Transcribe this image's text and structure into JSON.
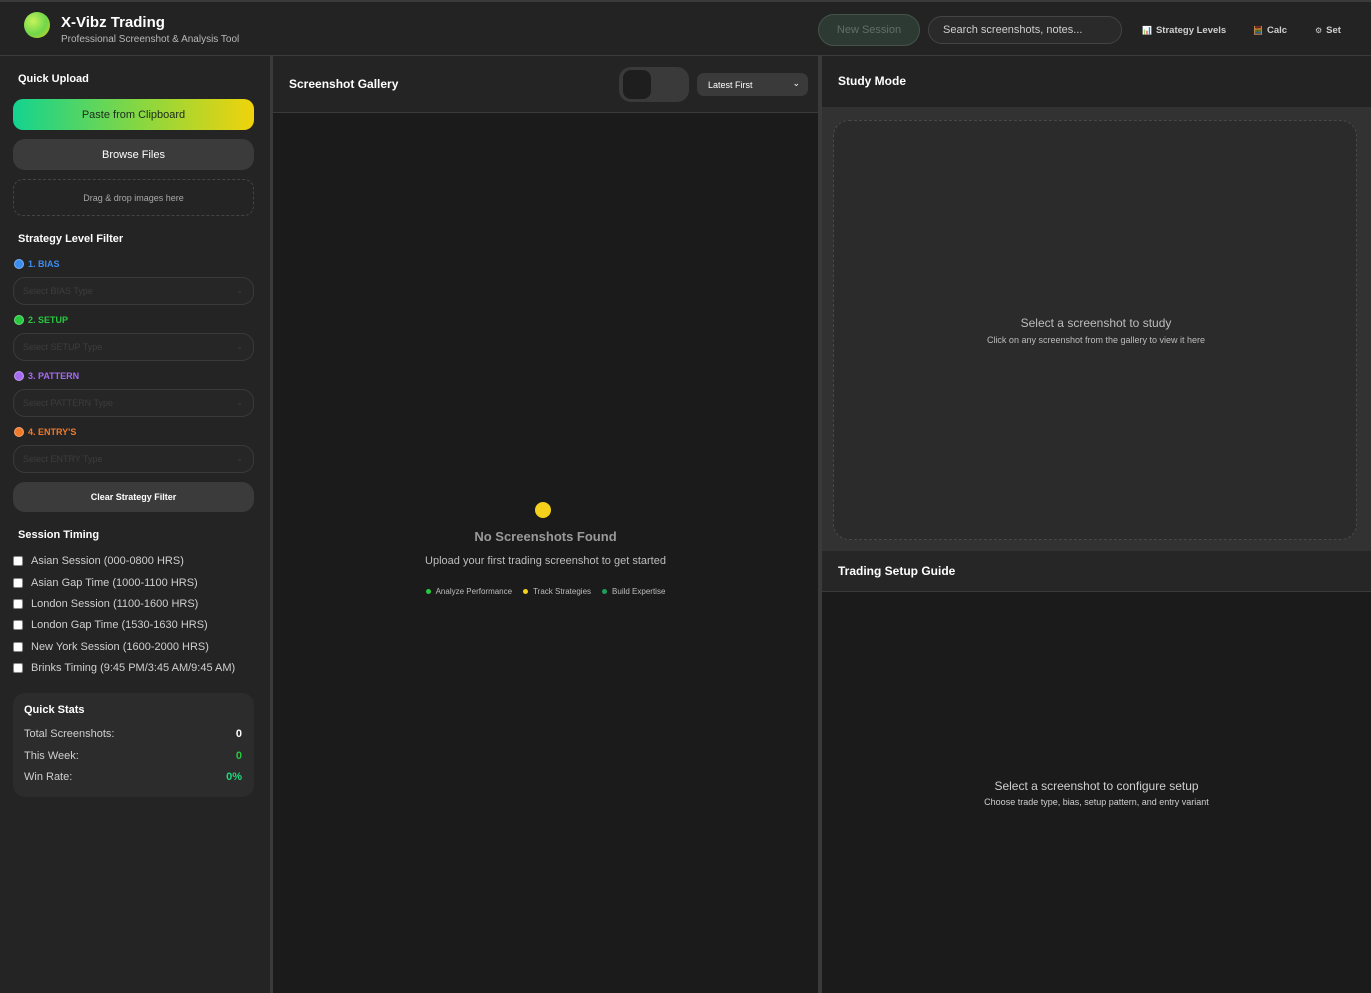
{
  "header": {
    "title": "X-Vibz Trading",
    "subtitle": "Professional Screenshot & Analysis Tool",
    "new_session_label": "New Session",
    "search_placeholder": "Search screenshots, notes...",
    "nav": [
      {
        "icon": "bar-chart-icon",
        "glyph": "📊",
        "label": "Strategy Levels"
      },
      {
        "icon": "calculator-icon",
        "glyph": "🧮",
        "label": "Calc"
      },
      {
        "icon": "gear-icon",
        "glyph": "⚙",
        "label": "Set"
      }
    ]
  },
  "sidebar": {
    "quick_upload_title": "Quick Upload",
    "paste_label": "Paste from Clipboard",
    "browse_label": "Browse Files",
    "drop_label": "Drag & drop images here",
    "strategy_title": "Strategy Level Filter",
    "levels": [
      {
        "label": "1. BIAS",
        "color": "#3b8df0",
        "placeholder": "Select BIAS Type"
      },
      {
        "label": "2. SETUP",
        "color": "#27c93f",
        "placeholder": "Select SETUP Type"
      },
      {
        "label": "3. PATTERN",
        "color": "#a66cf0",
        "placeholder": "Select PATTERN Type"
      },
      {
        "label": "4. ENTRY'S",
        "color": "#f07a2a",
        "placeholder": "Select ENTRY Type"
      }
    ],
    "clear_filter_label": "Clear Strategy Filter",
    "session_title": "Session Timing",
    "sessions": [
      "Asian Session (000-0800 HRS)",
      "Asian Gap Time (1000-1100 HRS)",
      "London Session (1100-1600 HRS)",
      "London Gap Time (1530-1630 HRS)",
      "New York Session (1600-2000 HRS)",
      "Brinks Timing (9:45 PM/3:45 AM/9:45 AM)"
    ],
    "stats": {
      "title": "Quick Stats",
      "rows": [
        {
          "label": "Total Screenshots:",
          "value": "0",
          "color": "#ffffff"
        },
        {
          "label": "This Week:",
          "value": "0",
          "color": "#27c93f"
        },
        {
          "label": "Win Rate:",
          "value": "0%",
          "color": "#1fd97c"
        }
      ]
    }
  },
  "gallery": {
    "title": "Screenshot Gallery",
    "sort_value": "Latest First",
    "empty_title": "No Screenshots Found",
    "empty_sub": "Upload your first trading screenshot to get started",
    "features": [
      {
        "label": "Analyze Performance",
        "color": "#27c93f"
      },
      {
        "label": "Track Strategies",
        "color": "#f5d11b"
      },
      {
        "label": "Build Expertise",
        "color": "#1f9e5c"
      }
    ]
  },
  "study": {
    "title": "Study Mode",
    "placeholder_title": "Select a screenshot to study",
    "placeholder_sub": "Click on any screenshot from the gallery to view it here"
  },
  "guide": {
    "title": "Trading Setup Guide",
    "placeholder_title": "Select a screenshot to configure setup",
    "placeholder_sub": "Choose trade type, bias, setup pattern, and entry variant"
  }
}
